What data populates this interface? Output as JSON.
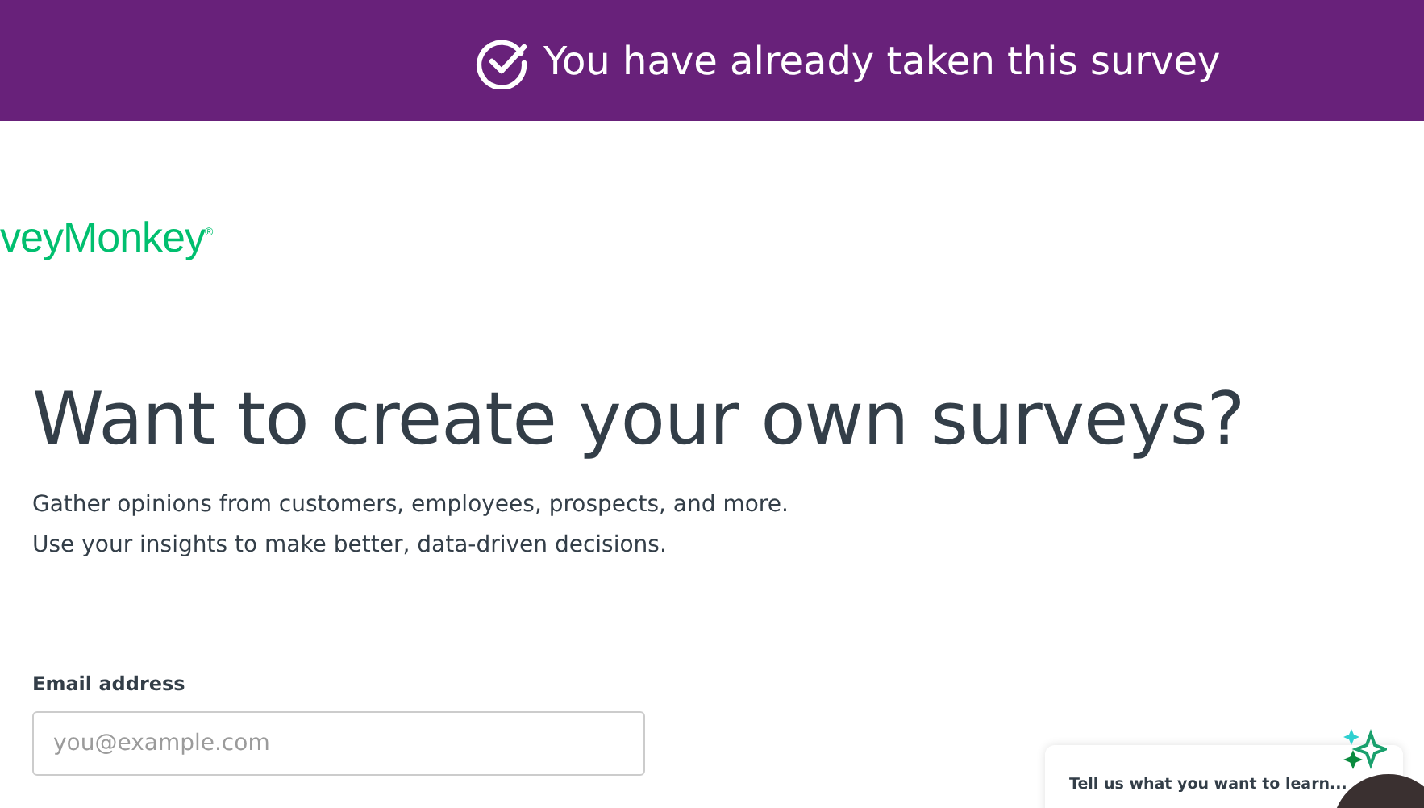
{
  "banner": {
    "message": "You have already taken this survey"
  },
  "logo": {
    "text": "veyMonkey$^{®}$"
  },
  "hero": {
    "heading": "Want to create your own surveys?",
    "lines": [
      "Gather opinions from customers, employees, prospects, and more.",
      "Use your insights to make better, data-driven decisions."
    ]
  },
  "email": {
    "label": "Email address",
    "placeholder": "you@example.com"
  },
  "promo_card": {
    "text": "Tell us what you want to learn..."
  }
}
